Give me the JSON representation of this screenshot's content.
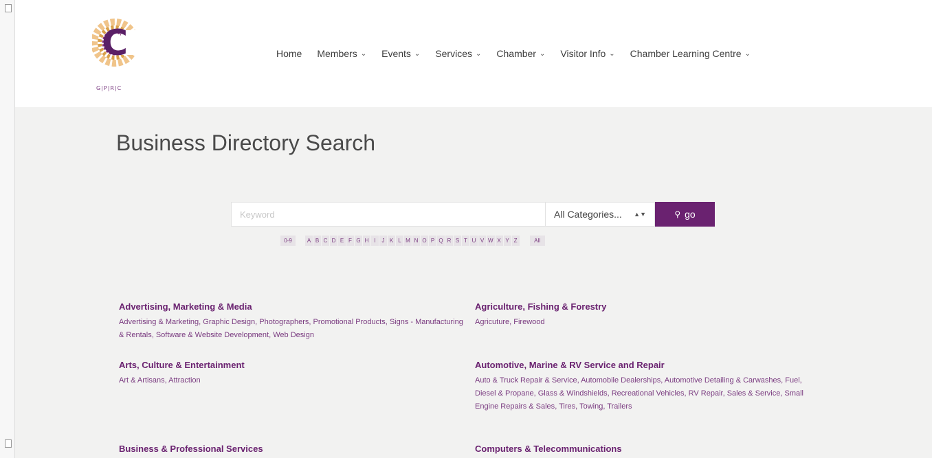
{
  "logo": {
    "text": "G|P|R|C",
    "icon": "gprc-c-logo-icon"
  },
  "nav": {
    "items": [
      {
        "label": "Home",
        "dropdown": false
      },
      {
        "label": "Members",
        "dropdown": true
      },
      {
        "label": "Events",
        "dropdown": true
      },
      {
        "label": "Services",
        "dropdown": true
      },
      {
        "label": "Chamber",
        "dropdown": true
      },
      {
        "label": "Visitor Info",
        "dropdown": true
      },
      {
        "label": "Chamber Learning Centre",
        "dropdown": true
      }
    ]
  },
  "page": {
    "title": "Business Directory Search"
  },
  "search": {
    "placeholder": "Keyword",
    "value": "",
    "category_selected": "All Categories...",
    "go_label": "go",
    "go_icon": "search-icon"
  },
  "alphabet": {
    "numeric_label": "0-9",
    "letters": [
      "A",
      "B",
      "C",
      "D",
      "E",
      "F",
      "G",
      "H",
      "I",
      "J",
      "K",
      "L",
      "M",
      "N",
      "O",
      "P",
      "Q",
      "R",
      "S",
      "T",
      "U",
      "V",
      "W",
      "X",
      "Y",
      "Z"
    ],
    "all_label": "All"
  },
  "categories": [
    {
      "title": "Advertising, Marketing & Media",
      "subs": [
        "Advertising & Marketing",
        "Graphic Design",
        "Photographers",
        "Promotional Products",
        "Signs - Manufacturing & Rentals",
        "Software & Website Development",
        "Web Design"
      ]
    },
    {
      "title": "Agriculture, Fishing & Forestry",
      "subs": [
        "Agricuture",
        "Firewood"
      ]
    },
    {
      "title": "Arts, Culture & Entertainment",
      "subs": [
        "Art & Artisans",
        "Attraction"
      ]
    },
    {
      "title": "Automotive, Marine & RV Service and Repair",
      "subs": [
        "Auto & Truck Repair & Service",
        "Automobile Dealerships",
        "Automotive Detailing & Carwashes",
        "Fuel, Diesel & Propane",
        "Glass & Windshields",
        "Recreational Vehicles",
        "RV Repair, Sales & Service",
        "Small Engine Repairs & Sales",
        "Tires",
        "Towing",
        "Trailers"
      ]
    },
    {
      "title": "Business & Professional Services",
      "subs": []
    },
    {
      "title": "Computers & Telecommunications",
      "subs": []
    }
  ],
  "colors": {
    "accent": "#6a2270",
    "link": "#7a3b80",
    "background": "#f2f2f1"
  }
}
